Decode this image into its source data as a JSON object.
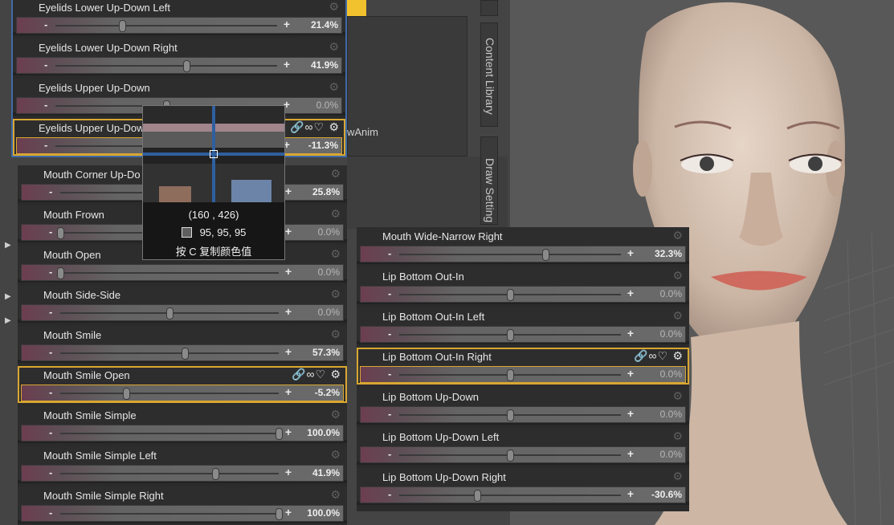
{
  "tabs": {
    "content_library": "Content Library",
    "draw_settings": "Draw Setting",
    "partial_label": "wAnim"
  },
  "colors": {
    "accent": "#d9a731",
    "tab_yellow": "#f2c12e",
    "slider_start": "#6c3e50"
  },
  "icons": [
    "gear-icon",
    "link-icon",
    "chain-icon",
    "heart-icon",
    "minus-icon",
    "plus-icon"
  ],
  "panel_top": [
    {
      "label": "Eyelids Lower Up-Down Left",
      "value": "21.4%",
      "pos": 0.3
    },
    {
      "label": "Eyelids Lower Up-Down Right",
      "value": "41.9%",
      "pos": 0.59
    },
    {
      "label": "Eyelids Upper Up-Down",
      "value": "0.0%",
      "pos": 0.5
    },
    {
      "label": "Eyelids Upper Up-Dow",
      "value": "-11.3%",
      "pos": 0.44,
      "selected": true
    }
  ],
  "panel_left": [
    {
      "label": "Mouth Corner Up-Do",
      "value": "25.8%",
      "pos": 0.63
    },
    {
      "label": "Mouth Frown",
      "value": "0.0%",
      "pos": 0.0
    },
    {
      "label": "Mouth Open",
      "value": "0.0%",
      "pos": 0.0
    },
    {
      "label": "Mouth Side-Side",
      "value": "0.0%",
      "pos": 0.5
    },
    {
      "label": "Mouth Smile",
      "value": "57.3%",
      "pos": 0.57
    },
    {
      "label": "Mouth Smile Open",
      "value": "-5.2%",
      "pos": 0.3,
      "selected": true
    },
    {
      "label": "Mouth Smile Simple",
      "value": "100.0%",
      "pos": 1.0
    },
    {
      "label": "Mouth Smile Simple Left",
      "value": "41.9%",
      "pos": 0.71
    },
    {
      "label": "Mouth Smile Simple Right",
      "value": "100.0%",
      "pos": 1.0
    }
  ],
  "panel_right": [
    {
      "label": "Mouth Wide-Narrow Right",
      "value": "32.3%",
      "pos": 0.66
    },
    {
      "label": "Lip Bottom Out-In",
      "value": "0.0%",
      "pos": 0.5
    },
    {
      "label": "Lip Bottom Out-In Left",
      "value": "0.0%",
      "pos": 0.5
    },
    {
      "label": "Lip Bottom Out-In Right",
      "value": "0.0%",
      "pos": 0.5,
      "selected": true
    },
    {
      "label": "Lip Bottom Up-Down",
      "value": "0.0%",
      "pos": 0.5
    },
    {
      "label": "Lip Bottom Up-Down Left",
      "value": "0.0%",
      "pos": 0.5
    },
    {
      "label": "Lip Bottom Up-Down Right",
      "value": "-30.6%",
      "pos": 0.35
    }
  ],
  "picker": {
    "coords": "(160 , 426)",
    "rgb": "95,  95,  95",
    "hint": "按 C 复制颜色值"
  }
}
